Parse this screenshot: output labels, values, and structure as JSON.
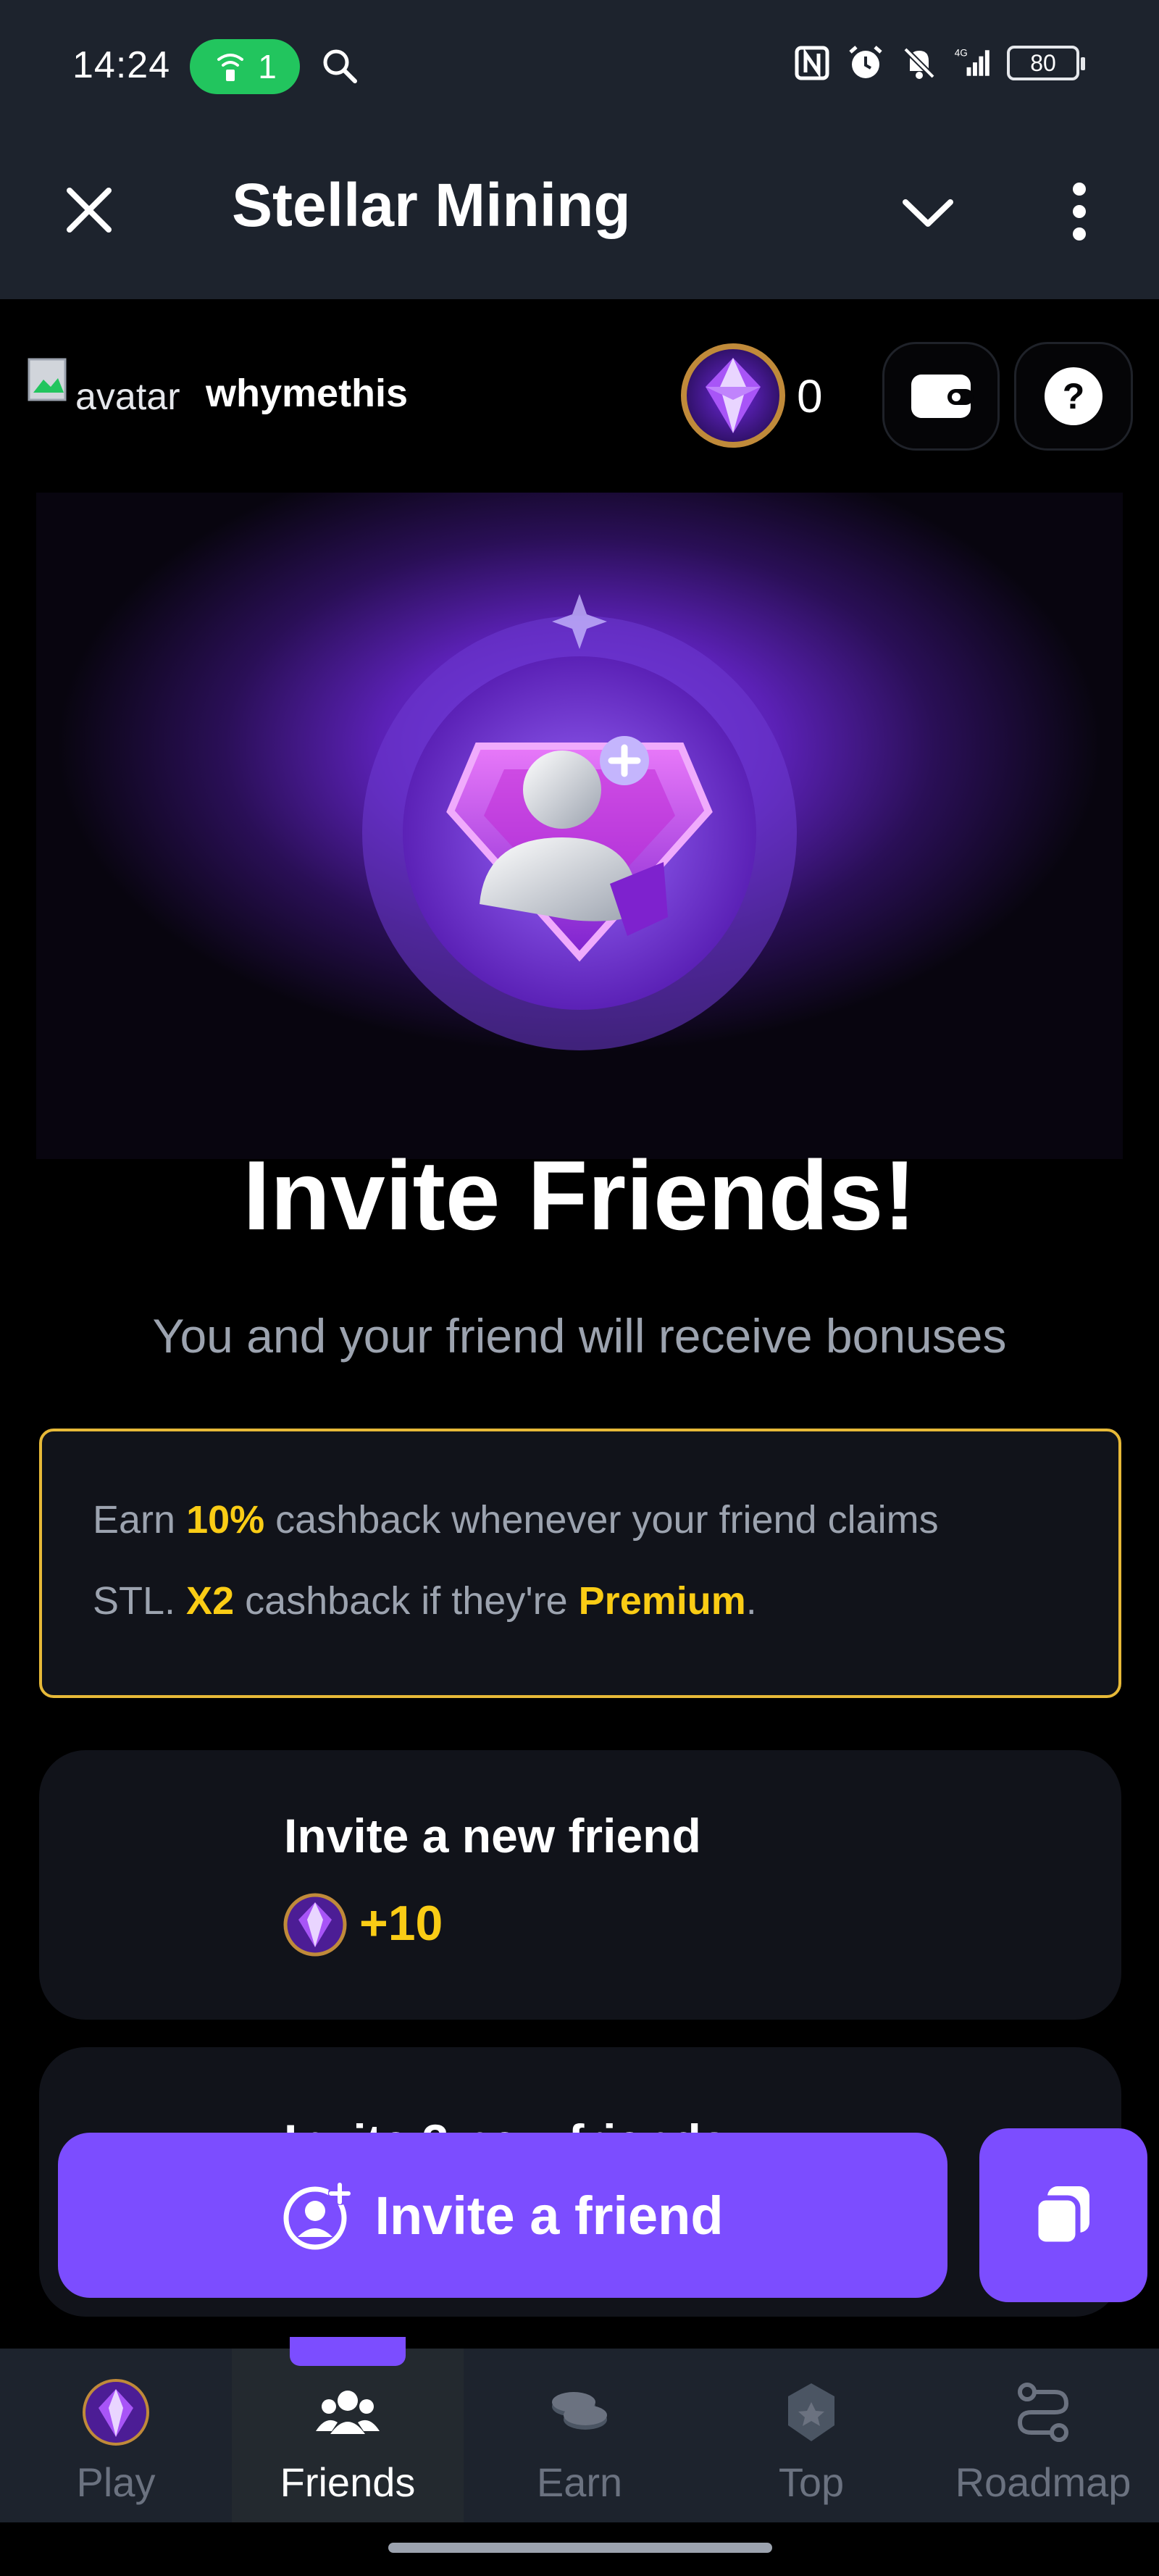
{
  "status_bar": {
    "time": "14:24",
    "hotspot_count": "1",
    "battery": "80",
    "icons": [
      "hotspot-icon",
      "search-icon",
      "nfc-icon",
      "alarm-icon",
      "bell-off-icon",
      "signal-4g-icon",
      "battery-icon"
    ]
  },
  "header": {
    "title": "Stellar Mining",
    "icons": [
      "close-icon",
      "chevron-down-icon",
      "kebab-menu-icon"
    ]
  },
  "user": {
    "avatar_alt": "avatar",
    "username": "whymethis",
    "balance": "0",
    "icons": [
      "gem-icon",
      "wallet-icon",
      "help-icon"
    ]
  },
  "hero": {
    "title": "Invite Friends!",
    "subtitle": "You and your friend will receive bonuses"
  },
  "cashback": {
    "text_1": "Earn ",
    "highlight_1": "10%",
    "text_2": " cashback whenever your friend claims",
    "text_3": "STL. ",
    "highlight_2": "X2",
    "text_4": " cashback if they're ",
    "highlight_3": "Premium",
    "text_5": "."
  },
  "rewards": [
    {
      "title": "Invite a new friend",
      "value": "+10"
    },
    {
      "title": "Invite 3 new friends"
    }
  ],
  "actions": {
    "invite_label": "Invite a friend",
    "icons": [
      "add-user-icon",
      "copy-icon"
    ]
  },
  "nav": {
    "items": [
      {
        "label": "Play",
        "icon": "gem-icon"
      },
      {
        "label": "Friends",
        "icon": "friends-icon",
        "active": true
      },
      {
        "label": "Earn",
        "icon": "coins-icon"
      },
      {
        "label": "Top",
        "icon": "trophy-icon"
      },
      {
        "label": "Roadmap",
        "icon": "roadmap-icon"
      }
    ]
  },
  "colors": {
    "accent": "#7c4dff",
    "highlight": "#facc15",
    "border_gold": "#e7b938",
    "header_bg": "#1d232d",
    "card_bg": "#11131a",
    "muted_text": "#9ca3af"
  }
}
